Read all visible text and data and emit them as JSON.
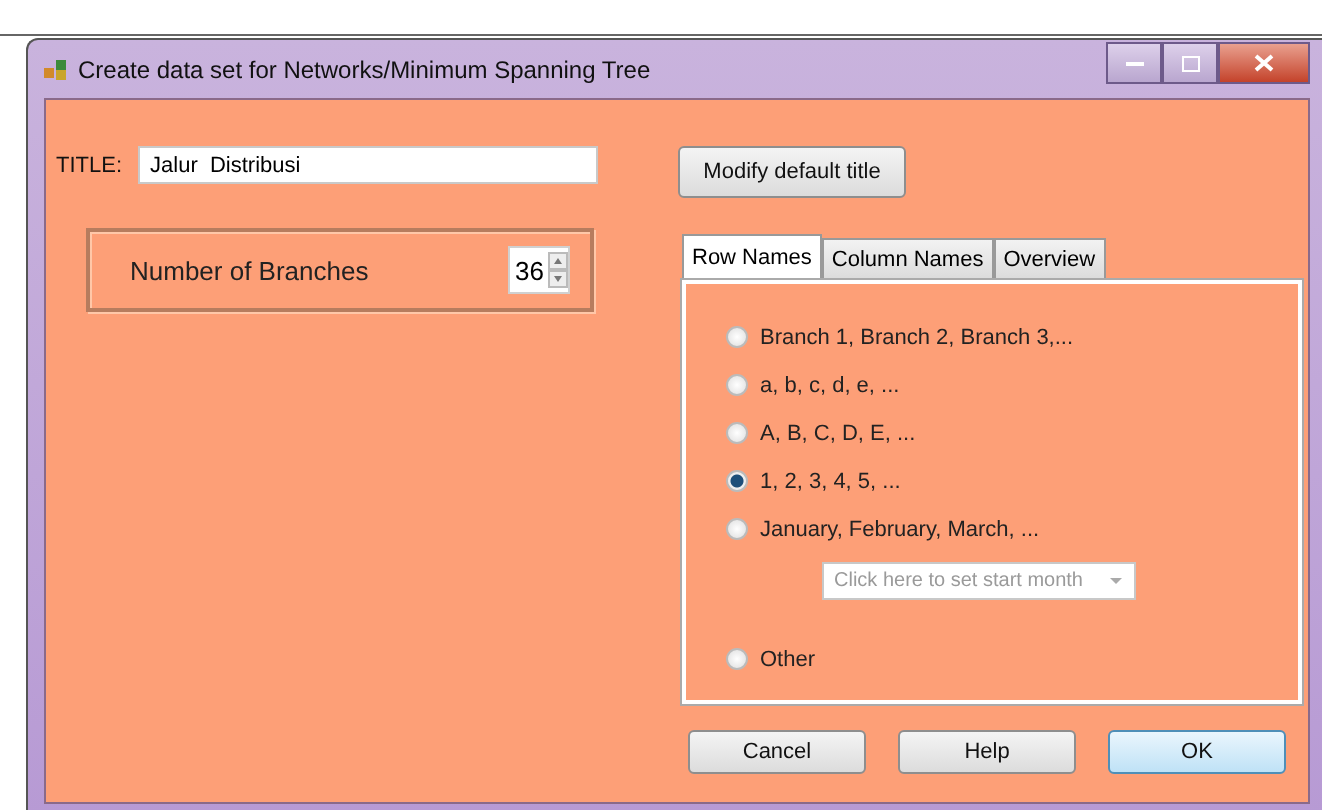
{
  "window": {
    "title": "Create data set for Networks/Minimum Spanning Tree"
  },
  "title_field": {
    "label": "TITLE:",
    "value": "Jalur  Distribusi"
  },
  "branches": {
    "label": "Number of Branches",
    "value": "36"
  },
  "modify_button": "Modify default title",
  "tabs": [
    {
      "label": "Row Names",
      "selected": true
    },
    {
      "label": "Column Names",
      "selected": false
    },
    {
      "label": "Overview",
      "selected": false
    }
  ],
  "row_options": [
    {
      "label": "Branch 1, Branch 2, Branch 3,...",
      "selected": false
    },
    {
      "label": "a, b, c, d, e, ...",
      "selected": false
    },
    {
      "label": "A, B, C, D, E, ...",
      "selected": false
    },
    {
      "label": "1, 2, 3, 4, 5, ...",
      "selected": true
    },
    {
      "label": "January, February, March, ...",
      "selected": false,
      "dropdown": {
        "placeholder": "Click here to set start month",
        "disabled": true
      }
    },
    {
      "label": "Other",
      "selected": false
    }
  ],
  "buttons": [
    {
      "label": "Cancel",
      "default": false
    },
    {
      "label": "Help",
      "default": false
    },
    {
      "label": "OK",
      "default": true
    }
  ]
}
